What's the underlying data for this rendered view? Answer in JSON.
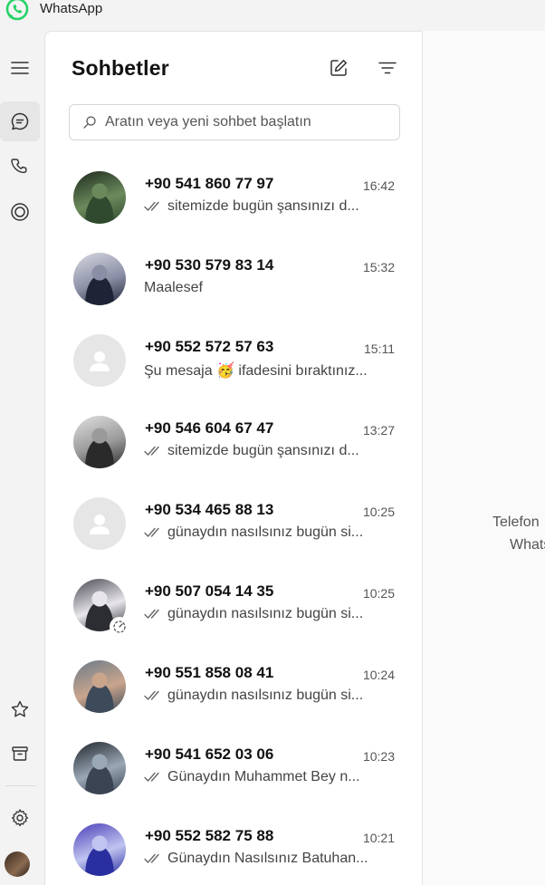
{
  "app": {
    "title": "WhatsApp",
    "brand_color": "#25d366"
  },
  "rail": {
    "top_items": [
      {
        "icon": "menu-icon"
      },
      {
        "icon": "chats-icon",
        "active": true
      },
      {
        "icon": "phone-icon"
      },
      {
        "icon": "status-icon"
      }
    ],
    "bottom_items": [
      {
        "icon": "star-icon"
      },
      {
        "icon": "archive-icon"
      },
      {
        "icon": "settings-icon"
      },
      {
        "icon": "profile-avatar"
      }
    ]
  },
  "panel": {
    "title": "Sohbetler",
    "new_chat_icon": "new-chat-icon",
    "filter_icon": "filter-icon",
    "search_placeholder": "Aratın veya yeni sohbet başlatın"
  },
  "chats": [
    {
      "name": "+90 541 860 77 97",
      "time": "16:42",
      "preview": "sitemizde bugün şansınızı d...",
      "ticks": true,
      "avatar": "photo",
      "avatar_colors": [
        "#2f4a2e",
        "#6b8a5c",
        "#1d2a1c"
      ]
    },
    {
      "name": "+90 530 579 83 14",
      "time": "15:32",
      "preview": "Maalesef",
      "ticks": false,
      "avatar": "photo",
      "avatar_colors": [
        "#1e2436",
        "#8a8fa6",
        "#d8d8e0"
      ]
    },
    {
      "name": "+90 552 572 57 63",
      "time": "15:11",
      "preview": "Şu mesaja 🥳 ifadesini bıraktınız...",
      "ticks": false,
      "avatar": "placeholder"
    },
    {
      "name": "+90 546 604 67 47",
      "time": "13:27",
      "preview": "sitemizde bugün şansınızı d...",
      "ticks": true,
      "avatar": "photo",
      "avatar_colors": [
        "#2a2a2a",
        "#9a9a9a",
        "#e0e0e0"
      ]
    },
    {
      "name": "+90 534 465 88 13",
      "time": "10:25",
      "preview": "günaydın nasılsınız bugün si...",
      "ticks": true,
      "avatar": "placeholder"
    },
    {
      "name": "+90 507 054 14 35",
      "time": "10:25",
      "preview": "günaydın nasılsınız bugün si...",
      "ticks": true,
      "avatar": "photo",
      "avatar_colors": [
        "#2c2c33",
        "#e8e6ea",
        "#4a4a55"
      ],
      "has_status": true
    },
    {
      "name": "+90 551 858 08 41",
      "time": "10:24",
      "preview": "günaydın nasılsınız bugün si...",
      "ticks": true,
      "avatar": "photo",
      "avatar_colors": [
        "#3d4a5a",
        "#c9a58c",
        "#6a7a8a"
      ]
    },
    {
      "name": "+90 541 652 03 06",
      "time": "10:23",
      "preview": "Günaydın Muhammet Bey n...",
      "ticks": true,
      "avatar": "photo",
      "avatar_colors": [
        "#3a4452",
        "#9aa7b5",
        "#1f242b"
      ]
    },
    {
      "name": "+90 552 582 75 88",
      "time": "10:21",
      "preview": "Günaydın Nasılsınız Batuhan...",
      "ticks": true,
      "avatar": "photo",
      "avatar_colors": [
        "#2a2fa0",
        "#c0c4f0",
        "#4b3fb8"
      ]
    }
  ],
  "right_pane": {
    "line1": "Telefon",
    "line2": "Whats"
  }
}
